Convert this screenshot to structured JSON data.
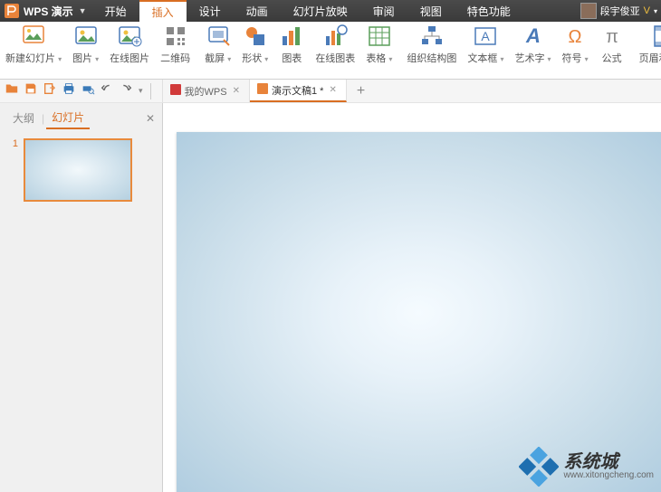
{
  "title": {
    "app_name": "WPS 演示",
    "user_name": "段宇俊亚"
  },
  "menu_tabs": {
    "items": [
      "开始",
      "插入",
      "设计",
      "动画",
      "幻灯片放映",
      "审阅",
      "视图",
      "特色功能"
    ],
    "active_index": 1
  },
  "ribbon": {
    "groups": [
      {
        "id": "new-slide",
        "label": "新建幻灯片",
        "icon": "new-slide-icon",
        "dd": true
      },
      {
        "id": "picture",
        "label": "图片",
        "icon": "picture-icon",
        "dd": true
      },
      {
        "id": "online-pic",
        "label": "在线图片",
        "icon": "online-picture-icon"
      },
      {
        "id": "qrcode",
        "label": "二维码",
        "icon": "qrcode-icon"
      },
      {
        "id": "screenshot",
        "label": "截屏",
        "icon": "screenshot-icon",
        "dd": true
      },
      {
        "id": "shapes",
        "label": "形状",
        "icon": "shapes-icon",
        "dd": true
      },
      {
        "id": "chart",
        "label": "图表",
        "icon": "chart-icon"
      },
      {
        "id": "online-chart",
        "label": "在线图表",
        "icon": "online-chart-icon"
      },
      {
        "id": "table",
        "label": "表格",
        "icon": "table-icon",
        "dd": true
      },
      {
        "id": "orgchart",
        "label": "组织结构图",
        "icon": "orgchart-icon"
      },
      {
        "id": "textbox",
        "label": "文本框",
        "icon": "textbox-icon",
        "dd": true
      },
      {
        "id": "wordart",
        "label": "艺术字",
        "icon": "wordart-icon",
        "dd": true
      },
      {
        "id": "symbol",
        "label": "符号",
        "icon": "symbol-icon",
        "dd": true
      },
      {
        "id": "equation",
        "label": "公式",
        "icon": "equation-icon"
      },
      {
        "id": "header-footer",
        "label": "页眉和页脚",
        "icon": "header-footer-icon"
      }
    ]
  },
  "qat": {
    "buttons": [
      {
        "id": "open",
        "icon": "folder-open-icon",
        "color": "#e8833a"
      },
      {
        "id": "save",
        "icon": "save-icon",
        "color": "#e8833a"
      },
      {
        "id": "export",
        "icon": "export-icon",
        "color": "#e8833a"
      },
      {
        "id": "print",
        "icon": "print-icon",
        "color": "#3a7ab8"
      },
      {
        "id": "print-preview",
        "icon": "print-preview-icon",
        "color": "#3a7ab8"
      },
      {
        "id": "undo",
        "icon": "undo-icon",
        "color": "#666"
      },
      {
        "id": "redo",
        "icon": "redo-icon",
        "color": "#666"
      }
    ]
  },
  "doc_tabs": {
    "items": [
      {
        "label": "我的WPS",
        "icon": "wps-icon",
        "active": false
      },
      {
        "label": "演示文稿1 *",
        "icon": "presentation-icon",
        "active": true
      }
    ],
    "add_label": "+"
  },
  "side_pane": {
    "tabs": {
      "outline": "大纲",
      "slides": "幻灯片"
    },
    "active": "slides",
    "slide_numbers": [
      "1"
    ]
  },
  "watermark": {
    "cn": "系统城",
    "url": "www.xitongcheng.com"
  }
}
